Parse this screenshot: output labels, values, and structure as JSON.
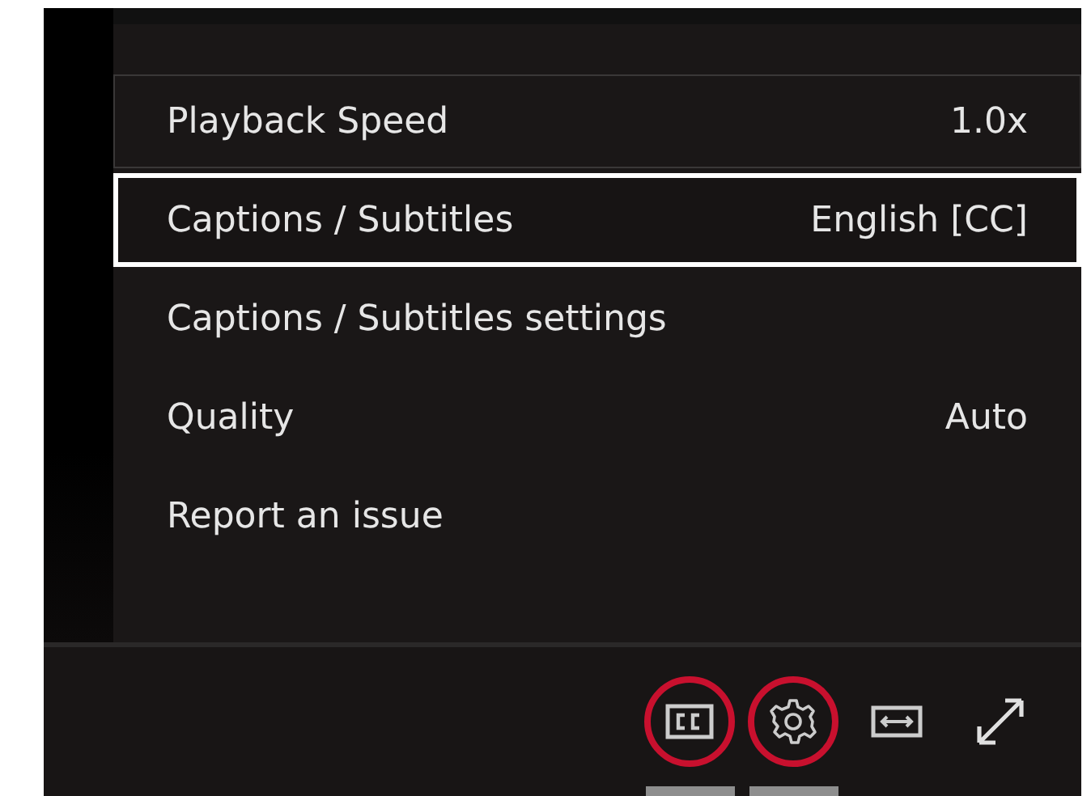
{
  "menu": {
    "items": [
      {
        "label": "Playback Speed",
        "value": "1.0x",
        "selected": false,
        "hovered": true
      },
      {
        "label": "Captions / Subtitles",
        "value": "English [CC]",
        "selected": true,
        "hovered": false
      },
      {
        "label": "Captions / Subtitles settings",
        "selected": false,
        "hovered": false
      },
      {
        "label": "Quality",
        "value": "Auto",
        "selected": false,
        "hovered": false
      },
      {
        "label": "Report an issue",
        "selected": false,
        "hovered": false
      }
    ]
  },
  "control_bar": {
    "buttons": [
      {
        "kind": "captions",
        "circled": true
      },
      {
        "kind": "settings",
        "circled": true
      },
      {
        "kind": "widen",
        "circled": false
      },
      {
        "kind": "fullscreen",
        "circled": false
      }
    ]
  }
}
